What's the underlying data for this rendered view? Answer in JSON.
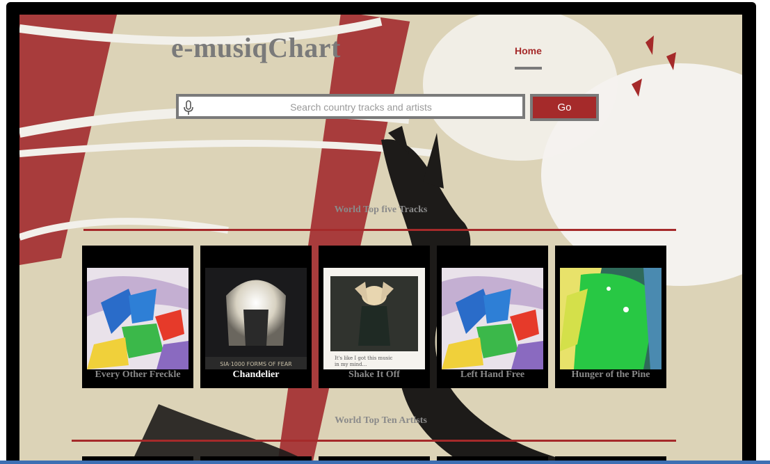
{
  "header": {
    "logo": "e-musiqChart",
    "nav": [
      {
        "label": "Home",
        "active": true
      }
    ]
  },
  "search": {
    "placeholder": "Search country tracks and artists",
    "value": "",
    "button_label": "Go",
    "icon": "microphone-icon"
  },
  "sections": {
    "tracks": {
      "title": "World Top five Tracks",
      "items": [
        {
          "title": "Every Other Freckle",
          "cover": "abstract-paint-cover",
          "highlighted": false
        },
        {
          "title": "Chandelier",
          "cover": "blonde-wig-cover",
          "highlighted": true
        },
        {
          "title": "Shake It Off",
          "cover": "polaroid-portrait-cover",
          "highlighted": false
        },
        {
          "title": "Left Hand Free",
          "cover": "abstract-paint-cover",
          "highlighted": false
        },
        {
          "title": "Hunger of the Pine",
          "cover": "green-paint-cover",
          "highlighted": false
        }
      ]
    },
    "artists": {
      "title": "World Top Ten Artists"
    }
  },
  "colors": {
    "accent": "#a52a2a",
    "muted_text": "#8a8a8a",
    "frame": "#000000",
    "background": "#dcd3b7"
  }
}
